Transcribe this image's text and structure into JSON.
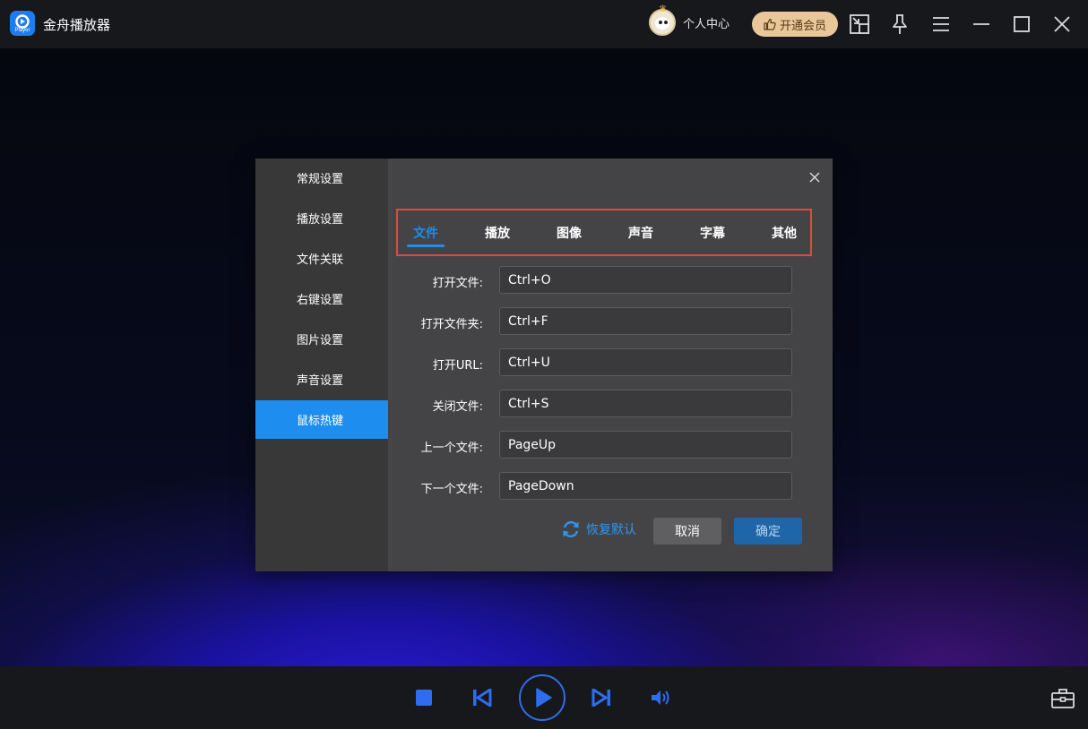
{
  "app": {
    "title": "金舟播放器",
    "logo_text": "Player"
  },
  "header": {
    "user_center_label": "个人中心",
    "vip_label": "开通会员"
  },
  "settings_dialog": {
    "sidebar": [
      {
        "label": "常规设置",
        "active": false
      },
      {
        "label": "播放设置",
        "active": false
      },
      {
        "label": "文件关联",
        "active": false
      },
      {
        "label": "右键设置",
        "active": false
      },
      {
        "label": "图片设置",
        "active": false
      },
      {
        "label": "声音设置",
        "active": false
      },
      {
        "label": "鼠标热键",
        "active": true
      }
    ],
    "tabs": [
      {
        "label": "文件",
        "active": true
      },
      {
        "label": "播放",
        "active": false
      },
      {
        "label": "图像",
        "active": false
      },
      {
        "label": "声音",
        "active": false
      },
      {
        "label": "字幕",
        "active": false
      },
      {
        "label": "其他",
        "active": false
      }
    ],
    "hotkeys": [
      {
        "label": "打开文件:",
        "value": "Ctrl+O"
      },
      {
        "label": "打开文件夹:",
        "value": "Ctrl+F"
      },
      {
        "label": "打开URL:",
        "value": "Ctrl+U"
      },
      {
        "label": "关闭文件:",
        "value": "Ctrl+S"
      },
      {
        "label": "上一个文件:",
        "value": "PageUp"
      },
      {
        "label": "下一个文件:",
        "value": "PageDown"
      }
    ],
    "restore_label": "恢复默认",
    "cancel_label": "取消",
    "ok_label": "确定"
  },
  "colors": {
    "accent": "#1d8df0",
    "highlight_border": "#e04a3b",
    "vip_bg": "#e9c79b",
    "control_blue": "#2f6cf0"
  }
}
